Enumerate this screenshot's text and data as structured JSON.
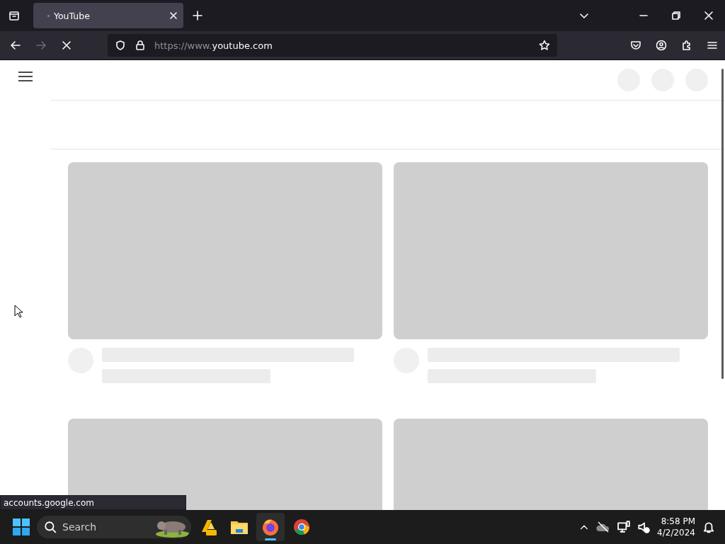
{
  "tabs": [
    {
      "label": "YouTube",
      "selected": true
    }
  ],
  "address_bar": {
    "url_prefix": "https://www.",
    "url_host": "youtube.com",
    "loading": true
  },
  "page": {
    "video_cards": [
      {
        "kind": "skeleton"
      },
      {
        "kind": "skeleton"
      },
      {
        "kind": "thumbnail_only"
      },
      {
        "kind": "thumbnail_only"
      }
    ]
  },
  "status_link": "accounts.google.com",
  "taskbar": {
    "search": {
      "placeholder": "Search"
    },
    "apps": [
      {
        "kind": "pre",
        "selected": false
      },
      {
        "kind": "folder",
        "selected": false
      },
      {
        "kind": "firefox",
        "selected": true
      },
      {
        "kind": "chrome",
        "selected": false
      }
    ],
    "time": "8:58 PM",
    "date": "4/2/2024"
  }
}
